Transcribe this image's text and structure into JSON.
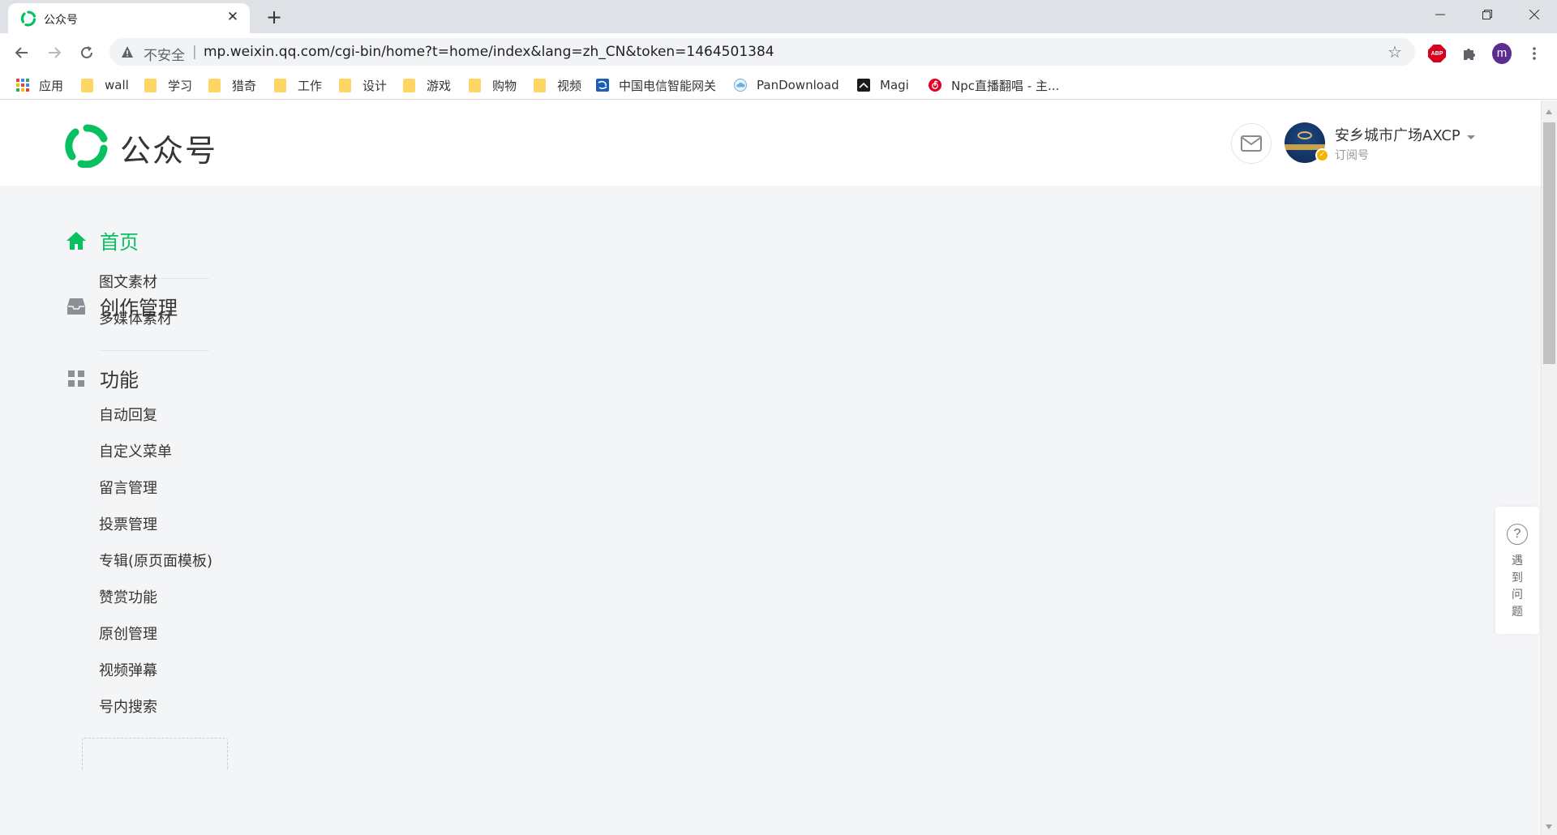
{
  "browser": {
    "tab": {
      "title": "公众号",
      "close_label": "✕"
    },
    "new_tab_label": "+",
    "address": {
      "security_label": "不安全",
      "separator": "|",
      "url": "mp.weixin.qq.com/cgi-bin/home?t=home/index&lang=zh_CN&token=1464501384"
    },
    "profile_initial": "m",
    "abp_label": "ABP",
    "bookmarks": [
      {
        "label": "应用",
        "icon": "apps-grid-icon"
      },
      {
        "label": "wall",
        "icon": "folder-icon"
      },
      {
        "label": "学习",
        "icon": "folder-icon"
      },
      {
        "label": "猎奇",
        "icon": "folder-icon"
      },
      {
        "label": "工作",
        "icon": "folder-icon"
      },
      {
        "label": "设计",
        "icon": "folder-icon"
      },
      {
        "label": "游戏",
        "icon": "folder-icon"
      },
      {
        "label": "购物",
        "icon": "folder-icon"
      },
      {
        "label": "视频",
        "icon": "folder-icon"
      },
      {
        "label": "中国电信智能网关",
        "icon": "china-telecom-icon"
      },
      {
        "label": "PanDownload",
        "icon": "cloud-icon"
      },
      {
        "label": "Magi",
        "icon": "magi-icon"
      },
      {
        "label": "Npc直播翻唱 - 主...",
        "icon": "netease-music-icon"
      }
    ]
  },
  "header": {
    "logo_text": "公众号",
    "account": {
      "name": "安乡城市广场AXCP",
      "type": "订阅号"
    }
  },
  "sidebar": {
    "home": {
      "label": "首页"
    },
    "sections": [
      {
        "label": "创作管理",
        "items": [
          "图文素材",
          "多媒体素材"
        ]
      },
      {
        "label": "功能",
        "items": [
          "自动回复",
          "自定义菜单",
          "留言管理",
          "投票管理",
          "专辑(原页面模板)",
          "赞赏功能",
          "原创管理",
          "视频弹幕",
          "号内搜索"
        ]
      }
    ]
  },
  "help": {
    "label": "遇到问题"
  },
  "colors": {
    "brand_green": "#07c160",
    "page_bg": "#f4f5f7",
    "tabstrip_bg": "#dee1e6"
  }
}
